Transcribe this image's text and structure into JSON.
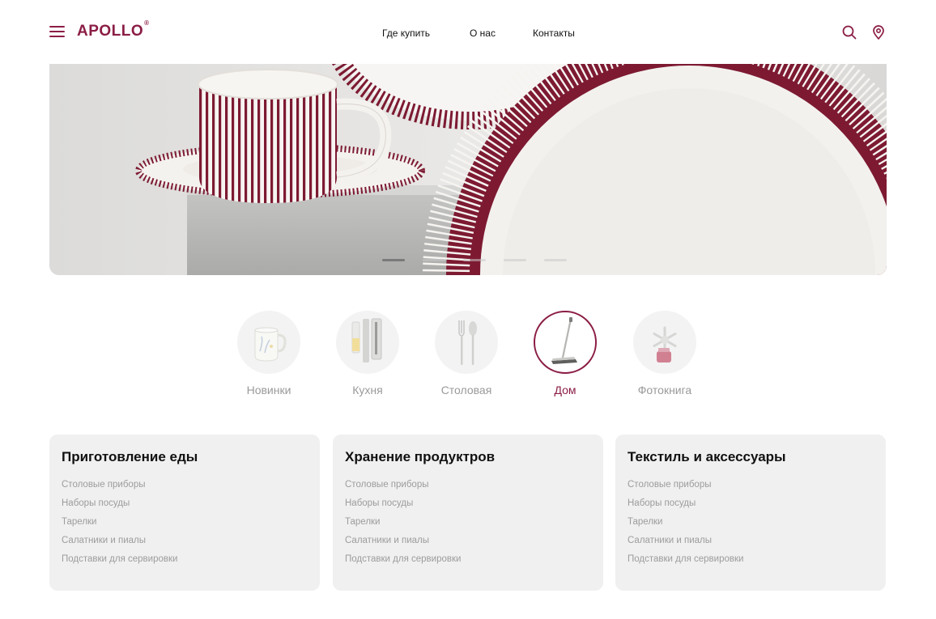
{
  "header": {
    "logo": "APOLLO",
    "logo_mark": "®",
    "nav": [
      "Где купить",
      "О нас",
      "Контакты"
    ],
    "icons": [
      "menu-icon",
      "search-icon",
      "location-pin-icon"
    ],
    "accent_color": "#8b1d45"
  },
  "hero": {
    "slides_total": 5,
    "active_slide": 1
  },
  "categories": [
    {
      "label": "Новинки",
      "icon": "mug-icon",
      "active": false
    },
    {
      "label": "Кухня",
      "icon": "kitchen-tools-icon",
      "active": false
    },
    {
      "label": "Столовая",
      "icon": "cutlery-icon",
      "active": false
    },
    {
      "label": "Дом",
      "icon": "mop-icon",
      "active": true
    },
    {
      "label": "Фотокнига",
      "icon": "snowflake-ornament-icon",
      "active": false
    }
  ],
  "cards": [
    {
      "title": "Приготовление еды",
      "items": [
        "Столовые приборы",
        "Наборы посуды",
        "Тарелки",
        "Салатники и пиалы",
        "Подставки для сервировки"
      ]
    },
    {
      "title": "Хранение продуктров",
      "items": [
        "Столовые приборы",
        "Наборы посуды",
        "Тарелки",
        "Салатники и пиалы",
        "Подставки для сервировки"
      ]
    },
    {
      "title": "Текстиль и аксессуары",
      "items": [
        "Столовые приборы",
        "Наборы посуды",
        "Тарелки",
        "Салатники и пиалы",
        "Подставки для сервировки"
      ]
    }
  ]
}
